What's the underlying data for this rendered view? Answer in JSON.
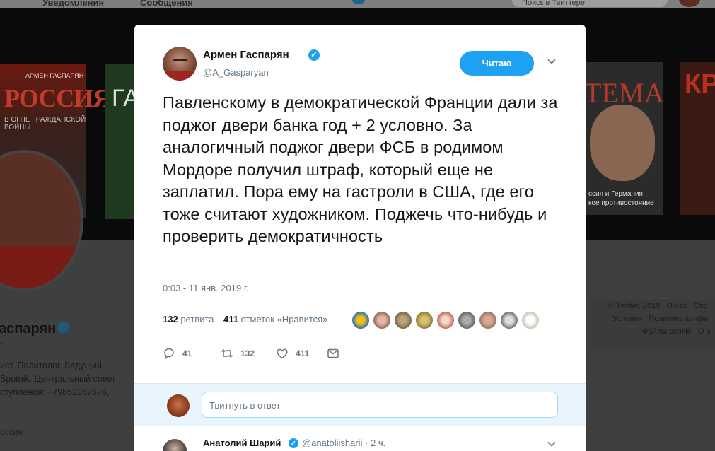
{
  "background": {
    "topbar": {
      "notifications": "Уведомления",
      "messages": "Сообщения",
      "search_placeholder": "Поиск в Твиттере"
    },
    "books": {
      "book1_author": "АРМЕН ГАСПАРЯН",
      "book1_title": "РОССИЯ",
      "book1_sub": "В ОГНЕ ГРАЖДАНСКОЙ ВОЙНЫ",
      "book2_title": "ГА",
      "book3_title": "ТЕМА",
      "book3_foot": "ссия и Германия\nкое противостояние",
      "book4_title": "КР"
    },
    "profile": {
      "name": "аспарян",
      "handle": "n",
      "bio": "ист. Политолог. Ведущий\nSputnik. Центральный совет\nступления: +79852267676,",
      "location": "оссия"
    },
    "footer": {
      "row1": [
        "© Twitter, 2019",
        "О нас",
        "Спр"
      ],
      "row2": [
        "Условия",
        "Политика конфи"
      ],
      "row3": [
        "Файлы cookie",
        "О р"
      ]
    }
  },
  "tweet": {
    "author_name": "Армен Гаспарян",
    "author_handle": "@A_Gasparyan",
    "follow_label": "Читаю",
    "text": "Павленскому в демократической Франции дали за поджог двери банка год + 2 условно. За аналогичный поджог двери ФСБ в родимом Мордоре получил штраф, который еще не заплатил. Пора ему на гастроли в США, где его тоже считают художником. Поджечь что-нибудь и проверить демократичность",
    "timestamp": "0:03 - 11 янв. 2019 г.",
    "retweets_count": "132",
    "retweets_label": "ретвита",
    "likes_count": "411",
    "likes_label": "отметок «Нравится»",
    "actions": {
      "replies": "41",
      "retweets": "132",
      "likes": "411"
    }
  },
  "reply": {
    "placeholder": "Твитнуть в ответ"
  },
  "next_tweet": {
    "author_name": "Анатолий Шарий",
    "author_handle": "@anatoliisharii · 2 ч."
  },
  "colors": {
    "accent": "#1da1f2",
    "text": "#14171a",
    "muted": "#657786"
  }
}
